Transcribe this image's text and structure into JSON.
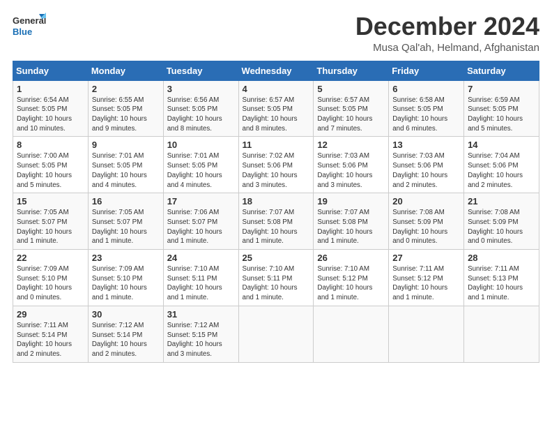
{
  "logo": {
    "line1": "General",
    "line2": "Blue"
  },
  "title": "December 2024",
  "location": "Musa Qal'ah, Helmand, Afghanistan",
  "days_of_week": [
    "Sunday",
    "Monday",
    "Tuesday",
    "Wednesday",
    "Thursday",
    "Friday",
    "Saturday"
  ],
  "weeks": [
    [
      {
        "num": "1",
        "sunrise": "6:54 AM",
        "sunset": "5:05 PM",
        "daylight": "10 hours and 10 minutes."
      },
      {
        "num": "2",
        "sunrise": "6:55 AM",
        "sunset": "5:05 PM",
        "daylight": "10 hours and 9 minutes."
      },
      {
        "num": "3",
        "sunrise": "6:56 AM",
        "sunset": "5:05 PM",
        "daylight": "10 hours and 8 minutes."
      },
      {
        "num": "4",
        "sunrise": "6:57 AM",
        "sunset": "5:05 PM",
        "daylight": "10 hours and 8 minutes."
      },
      {
        "num": "5",
        "sunrise": "6:57 AM",
        "sunset": "5:05 PM",
        "daylight": "10 hours and 7 minutes."
      },
      {
        "num": "6",
        "sunrise": "6:58 AM",
        "sunset": "5:05 PM",
        "daylight": "10 hours and 6 minutes."
      },
      {
        "num": "7",
        "sunrise": "6:59 AM",
        "sunset": "5:05 PM",
        "daylight": "10 hours and 5 minutes."
      }
    ],
    [
      {
        "num": "8",
        "sunrise": "7:00 AM",
        "sunset": "5:05 PM",
        "daylight": "10 hours and 5 minutes."
      },
      {
        "num": "9",
        "sunrise": "7:01 AM",
        "sunset": "5:05 PM",
        "daylight": "10 hours and 4 minutes."
      },
      {
        "num": "10",
        "sunrise": "7:01 AM",
        "sunset": "5:05 PM",
        "daylight": "10 hours and 4 minutes."
      },
      {
        "num": "11",
        "sunrise": "7:02 AM",
        "sunset": "5:06 PM",
        "daylight": "10 hours and 3 minutes."
      },
      {
        "num": "12",
        "sunrise": "7:03 AM",
        "sunset": "5:06 PM",
        "daylight": "10 hours and 3 minutes."
      },
      {
        "num": "13",
        "sunrise": "7:03 AM",
        "sunset": "5:06 PM",
        "daylight": "10 hours and 2 minutes."
      },
      {
        "num": "14",
        "sunrise": "7:04 AM",
        "sunset": "5:06 PM",
        "daylight": "10 hours and 2 minutes."
      }
    ],
    [
      {
        "num": "15",
        "sunrise": "7:05 AM",
        "sunset": "5:07 PM",
        "daylight": "10 hours and 1 minute."
      },
      {
        "num": "16",
        "sunrise": "7:05 AM",
        "sunset": "5:07 PM",
        "daylight": "10 hours and 1 minute."
      },
      {
        "num": "17",
        "sunrise": "7:06 AM",
        "sunset": "5:07 PM",
        "daylight": "10 hours and 1 minute."
      },
      {
        "num": "18",
        "sunrise": "7:07 AM",
        "sunset": "5:08 PM",
        "daylight": "10 hours and 1 minute."
      },
      {
        "num": "19",
        "sunrise": "7:07 AM",
        "sunset": "5:08 PM",
        "daylight": "10 hours and 1 minute."
      },
      {
        "num": "20",
        "sunrise": "7:08 AM",
        "sunset": "5:09 PM",
        "daylight": "10 hours and 0 minutes."
      },
      {
        "num": "21",
        "sunrise": "7:08 AM",
        "sunset": "5:09 PM",
        "daylight": "10 hours and 0 minutes."
      }
    ],
    [
      {
        "num": "22",
        "sunrise": "7:09 AM",
        "sunset": "5:10 PM",
        "daylight": "10 hours and 0 minutes."
      },
      {
        "num": "23",
        "sunrise": "7:09 AM",
        "sunset": "5:10 PM",
        "daylight": "10 hours and 1 minute."
      },
      {
        "num": "24",
        "sunrise": "7:10 AM",
        "sunset": "5:11 PM",
        "daylight": "10 hours and 1 minute."
      },
      {
        "num": "25",
        "sunrise": "7:10 AM",
        "sunset": "5:11 PM",
        "daylight": "10 hours and 1 minute."
      },
      {
        "num": "26",
        "sunrise": "7:10 AM",
        "sunset": "5:12 PM",
        "daylight": "10 hours and 1 minute."
      },
      {
        "num": "27",
        "sunrise": "7:11 AM",
        "sunset": "5:12 PM",
        "daylight": "10 hours and 1 minute."
      },
      {
        "num": "28",
        "sunrise": "7:11 AM",
        "sunset": "5:13 PM",
        "daylight": "10 hours and 1 minute."
      }
    ],
    [
      {
        "num": "29",
        "sunrise": "7:11 AM",
        "sunset": "5:14 PM",
        "daylight": "10 hours and 2 minutes."
      },
      {
        "num": "30",
        "sunrise": "7:12 AM",
        "sunset": "5:14 PM",
        "daylight": "10 hours and 2 minutes."
      },
      {
        "num": "31",
        "sunrise": "7:12 AM",
        "sunset": "5:15 PM",
        "daylight": "10 hours and 3 minutes."
      },
      null,
      null,
      null,
      null
    ]
  ]
}
